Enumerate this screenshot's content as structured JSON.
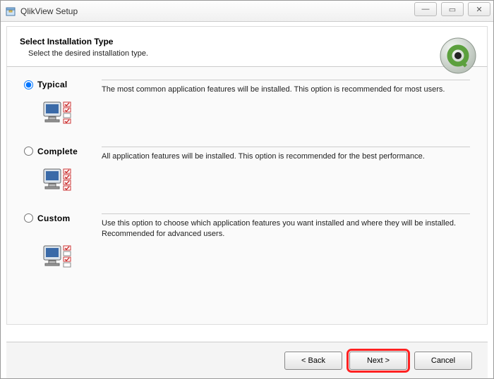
{
  "window": {
    "title": "QlikView Setup"
  },
  "header": {
    "title": "Select Installation Type",
    "subtitle": "Select the desired installation type."
  },
  "options": {
    "typical": {
      "label": "Typical",
      "description": "The most common application features will be installed. This option is recommended for most users.",
      "selected": true
    },
    "complete": {
      "label": "Complete",
      "description": "All application features will be installed. This option is recommended for the best performance.",
      "selected": false
    },
    "custom": {
      "label": "Custom",
      "description": "Use this option to choose which application features you want installed and where they will be installed. Recommended for advanced users.",
      "selected": false
    }
  },
  "buttons": {
    "back": "< Back",
    "next": "Next >",
    "cancel": "Cancel"
  },
  "win_controls": {
    "minimize": "—",
    "maximize": "▭",
    "close": "✕"
  }
}
